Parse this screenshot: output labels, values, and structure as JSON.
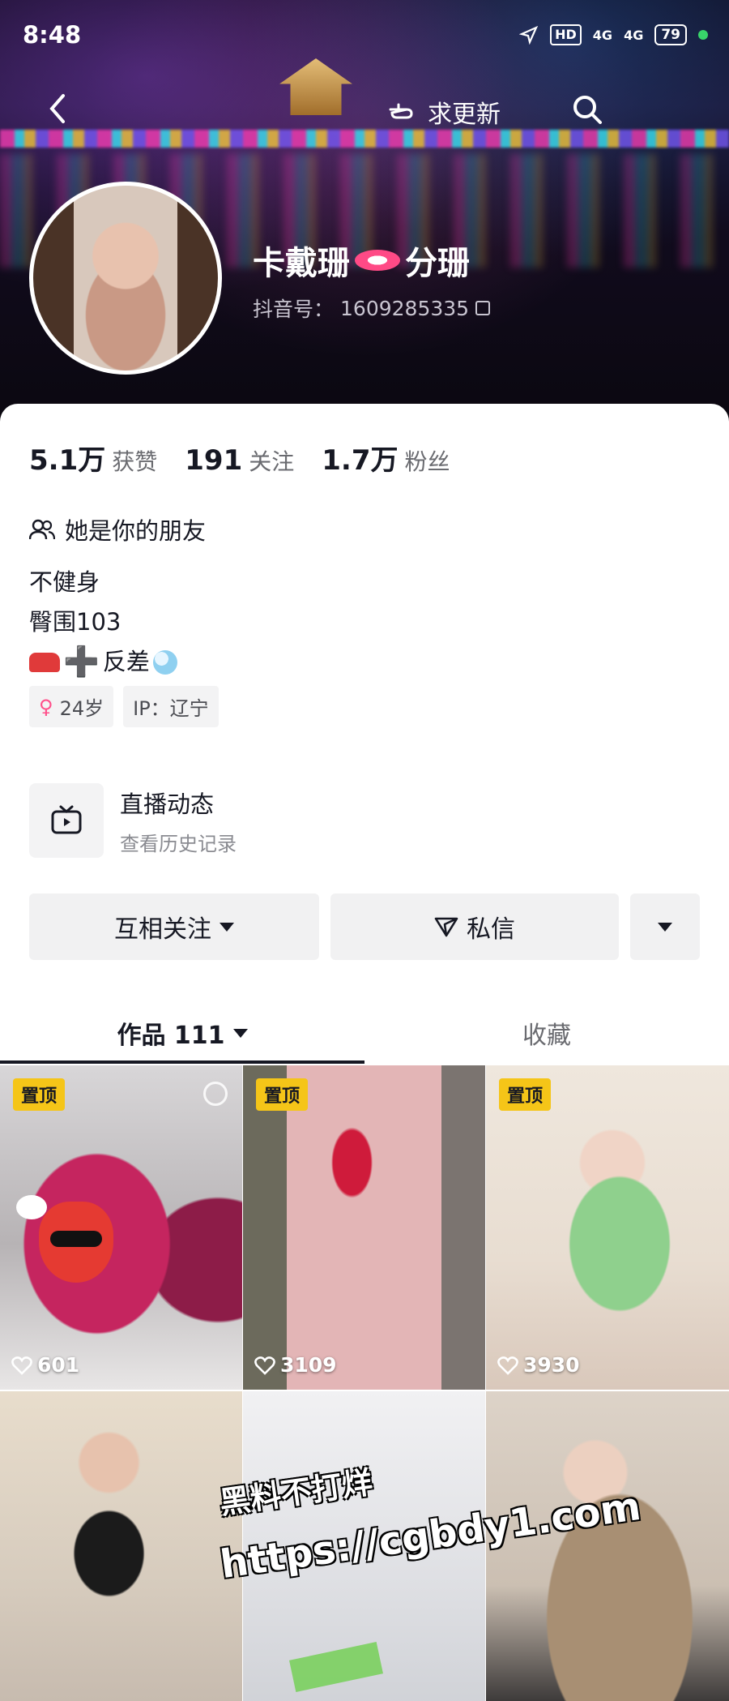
{
  "status_bar": {
    "time": "8:48",
    "hd": "HD",
    "net1": "4G",
    "net2": "4G",
    "battery": "79"
  },
  "topbar": {
    "update_label": "求更新"
  },
  "profile": {
    "name_left": "卡戴珊",
    "name_right": "分珊",
    "douyin_id_label": "抖音号：",
    "douyin_id": "1609285335"
  },
  "stats": [
    {
      "num": "5.1万",
      "label": "获赞"
    },
    {
      "num": "191",
      "label": "关注"
    },
    {
      "num": "1.7万",
      "label": "粉丝"
    }
  ],
  "friend_text": "她是你的朋友",
  "bio": {
    "line1": "不健身",
    "line2": "臀围103",
    "line3_text": "反差"
  },
  "tags": {
    "age": "24岁",
    "ip": "IP：辽宁"
  },
  "live": {
    "title": "直播动态",
    "subtitle": "查看历史记录"
  },
  "actions": {
    "follow": "互相关注",
    "message": "私信"
  },
  "tabs": {
    "works": "作品 111",
    "favorites": "收藏"
  },
  "videos": [
    {
      "pinned": "置顶",
      "likes": "601"
    },
    {
      "pinned": "置顶",
      "likes": "3109"
    },
    {
      "pinned": "置顶",
      "likes": "3930"
    },
    {
      "pinned": "",
      "likes": ""
    },
    {
      "pinned": "",
      "likes": ""
    },
    {
      "pinned": "",
      "likes": ""
    }
  ],
  "watermark": {
    "line1": "黑料不打烊",
    "line2": "https://cgbdy1.com"
  },
  "icons": {
    "back": "chevron-left-icon",
    "hand": "pointing-hand-icon",
    "search": "search-icon",
    "copy": "copy-icon",
    "friends": "friends-icon",
    "tv": "tv-icon",
    "send": "send-icon",
    "heart": "heart-icon"
  },
  "colors": {
    "pin": "#f5c518",
    "female": "#ff4f8a",
    "text": "#161823"
  }
}
